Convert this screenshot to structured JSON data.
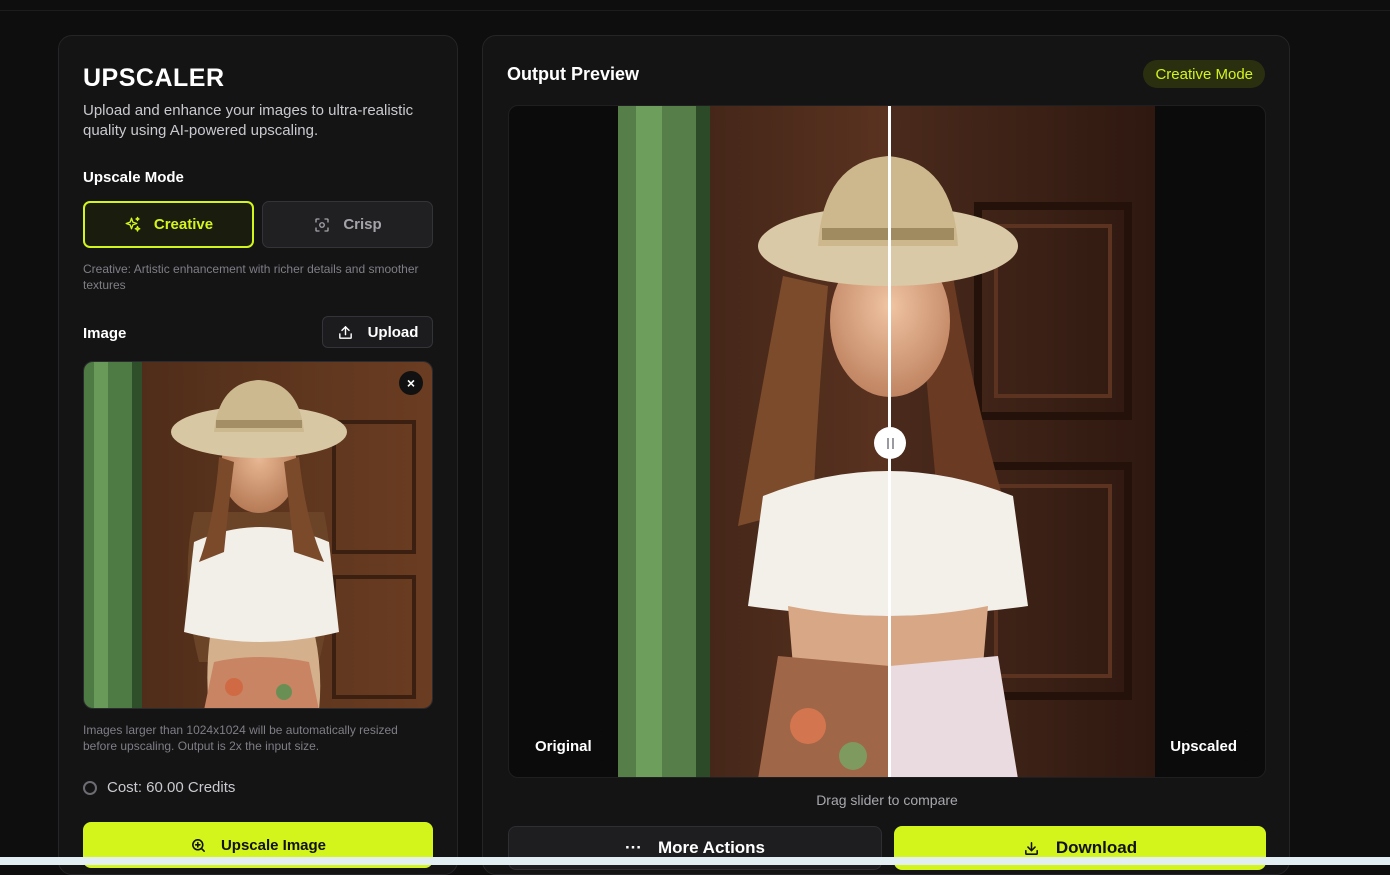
{
  "sidebar": {
    "title": "UPSCALER",
    "description": "Upload and enhance your images to ultra-realistic quality using AI-powered upscaling.",
    "mode_label": "Upscale Mode",
    "modes": [
      {
        "label": "Creative",
        "icon": "sparkles-icon",
        "selected": true
      },
      {
        "label": "Crisp",
        "icon": "focus-icon",
        "selected": false
      }
    ],
    "mode_hint": "Creative: Artistic enhancement with richer details and smoother textures",
    "image_label": "Image",
    "upload_label": "Upload",
    "close_symbol": "×",
    "image_note": "Images larger than 1024x1024 will be automatically resized before upscaling. Output is 2x the input size.",
    "cost": "Cost: 60.00 Credits",
    "upscale_button": "Upscale Image"
  },
  "preview": {
    "title": "Output Preview",
    "badge": "Creative Mode",
    "original_tag": "Original",
    "upscaled_tag": "Upscaled",
    "slider_split": 0.5,
    "drag_hint": "Drag slider to compare",
    "more_actions": "More Actions",
    "more_symbol": "···",
    "download": "Download"
  },
  "colors": {
    "accent": "#d4f51b",
    "background": "#0e0e0f",
    "panel": "#141415"
  }
}
